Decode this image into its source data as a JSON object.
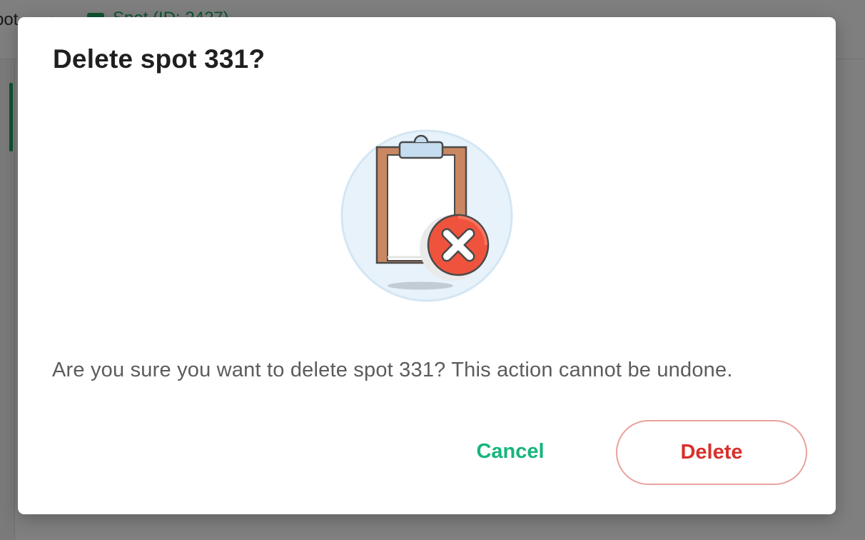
{
  "background": {
    "breadcrumb_left": "pot",
    "breadcrumb_separator": "›",
    "breadcrumb_current": "Spot (ID: 2427)"
  },
  "dialog": {
    "title": "Delete spot 331?",
    "illustration_icon": "clipboard-delete-icon",
    "message": "Are you sure you want to delete spot 331? This action cannot be undone.",
    "cancel_label": "Cancel",
    "delete_label": "Delete"
  },
  "colors": {
    "accent_green": "#17b57b",
    "danger_red": "#d8302c",
    "danger_border": "#e8a29c"
  }
}
